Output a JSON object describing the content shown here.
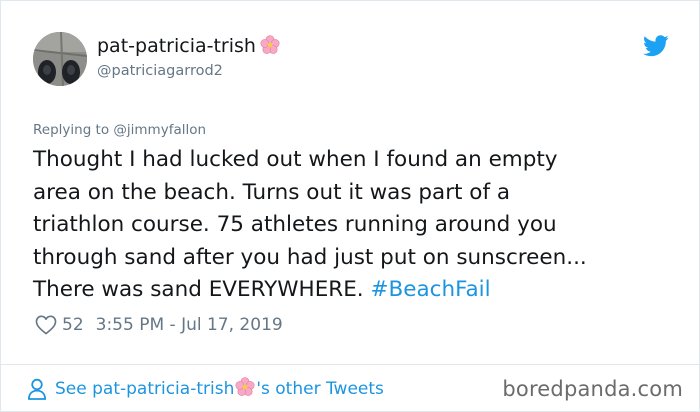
{
  "user": {
    "display_name": "pat-patricia-trish",
    "handle": "@patriciagarrod2",
    "avatar_icon": "avatar-photo",
    "name_emoji_icon": "cherry-blossom-icon"
  },
  "reply": {
    "text": "Replying to @jimmyfallon"
  },
  "tweet": {
    "lines": [
      "Thought I had lucked out when I found an empty",
      "area on the beach. Turns out it was part of a",
      "triathlon course. 75 athletes running around you",
      "through sand after you had just put on sunscreen...",
      "There was sand EVERYWHERE. "
    ],
    "hashtag": "#BeachFail"
  },
  "meta": {
    "likes": "52",
    "timestamp": "3:55 PM - Jul 17, 2019"
  },
  "footer": {
    "see_prefix": "See pat-patricia-trish",
    "see_suffix": "'s other Tweets"
  },
  "watermark": "boredpanda.com",
  "colors": {
    "link": "#1b95e0",
    "text": "#14171a",
    "muted": "#657786",
    "border": "#e1e8ed"
  }
}
